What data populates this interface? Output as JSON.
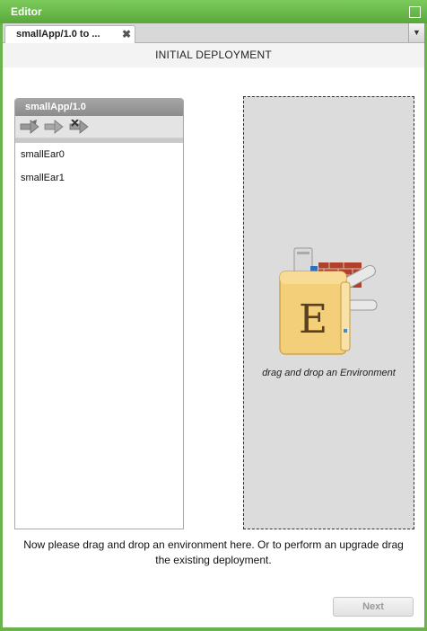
{
  "window": {
    "title": "Editor"
  },
  "tabs": [
    {
      "label": "smallApp/1.0 to ..."
    }
  ],
  "page": {
    "heading": "INITIAL DEPLOYMENT"
  },
  "app_panel": {
    "title": "smallApp/1.0",
    "toolbar_icons": [
      "deploy-arrow-icon",
      "move-arrow-icon",
      "remove-arrow-icon"
    ],
    "items": [
      "smallEar0",
      "smallEar1"
    ]
  },
  "dropzone": {
    "label": "drag and drop an Environment",
    "icon": "environment-folder-icon"
  },
  "instructions": "Now please drag and drop an environment here. Or to perform an upgrade drag the existing deployment.",
  "buttons": {
    "next": "Next"
  },
  "colors": {
    "title_bar": "#6cb24e",
    "panel_header": "#999999",
    "dropzone_bg": "#dcdcdc"
  }
}
